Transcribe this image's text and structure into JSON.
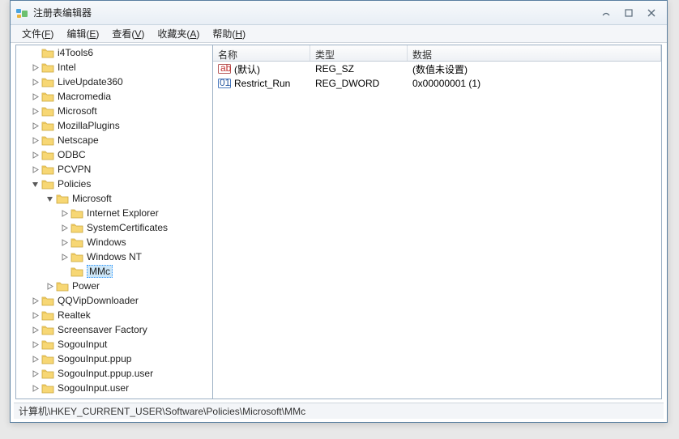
{
  "window": {
    "title": "注册表编辑器"
  },
  "menubar": [
    {
      "label": "文件",
      "accel": "F"
    },
    {
      "label": "编辑",
      "accel": "E"
    },
    {
      "label": "查看",
      "accel": "V"
    },
    {
      "label": "收藏夹",
      "accel": "A"
    },
    {
      "label": "帮助",
      "accel": "H"
    }
  ],
  "tree": {
    "items": [
      {
        "label": "i4Tools6",
        "level": 1,
        "exp": "leaf"
      },
      {
        "label": "Intel",
        "level": 1,
        "exp": "closed"
      },
      {
        "label": "LiveUpdate360",
        "level": 1,
        "exp": "closed"
      },
      {
        "label": "Macromedia",
        "level": 1,
        "exp": "closed"
      },
      {
        "label": "Microsoft",
        "level": 1,
        "exp": "closed"
      },
      {
        "label": "MozillaPlugins",
        "level": 1,
        "exp": "closed"
      },
      {
        "label": "Netscape",
        "level": 1,
        "exp": "closed"
      },
      {
        "label": "ODBC",
        "level": 1,
        "exp": "closed"
      },
      {
        "label": "PCVPN",
        "level": 1,
        "exp": "closed"
      },
      {
        "label": "Policies",
        "level": 1,
        "exp": "open"
      },
      {
        "label": "Microsoft",
        "level": 2,
        "exp": "open"
      },
      {
        "label": "Internet Explorer",
        "level": 3,
        "exp": "closed"
      },
      {
        "label": "SystemCertificates",
        "level": 3,
        "exp": "closed"
      },
      {
        "label": "Windows",
        "level": 3,
        "exp": "closed"
      },
      {
        "label": "Windows NT",
        "level": 3,
        "exp": "closed"
      },
      {
        "label": "MMc",
        "level": 3,
        "exp": "leaf",
        "selected": true
      },
      {
        "label": "Power",
        "level": 2,
        "exp": "closed"
      },
      {
        "label": "QQVipDownloader",
        "level": 1,
        "exp": "closed"
      },
      {
        "label": "Realtek",
        "level": 1,
        "exp": "closed"
      },
      {
        "label": "Screensaver Factory",
        "level": 1,
        "exp": "closed"
      },
      {
        "label": "SogouInput",
        "level": 1,
        "exp": "closed"
      },
      {
        "label": "SogouInput.ppup",
        "level": 1,
        "exp": "closed"
      },
      {
        "label": "SogouInput.ppup.user",
        "level": 1,
        "exp": "closed"
      },
      {
        "label": "SogouInput.user",
        "level": 1,
        "exp": "closed"
      }
    ]
  },
  "columns": {
    "name": "名称",
    "type": "类型",
    "data": "数据"
  },
  "values": [
    {
      "icon": "ab",
      "name": "(默认)",
      "type": "REG_SZ",
      "data": "(数值未设置)"
    },
    {
      "icon": "bin",
      "name": "Restrict_Run",
      "type": "REG_DWORD",
      "data": "0x00000001 (1)"
    }
  ],
  "statusbar": "计算机\\HKEY_CURRENT_USER\\Software\\Policies\\Microsoft\\MMc"
}
